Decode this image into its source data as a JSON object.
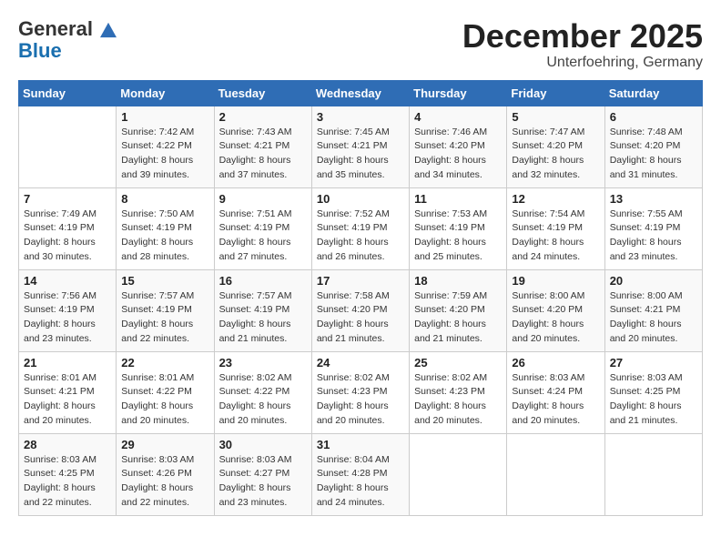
{
  "logo": {
    "general": "General",
    "blue": "Blue"
  },
  "title": "December 2025",
  "subtitle": "Unterfoehring, Germany",
  "weekdays": [
    "Sunday",
    "Monday",
    "Tuesday",
    "Wednesday",
    "Thursday",
    "Friday",
    "Saturday"
  ],
  "weeks": [
    [
      {
        "day": "",
        "sunrise": "",
        "sunset": "",
        "daylight": ""
      },
      {
        "day": "1",
        "sunrise": "7:42 AM",
        "sunset": "4:22 PM",
        "daylight": "8 hours and 39 minutes."
      },
      {
        "day": "2",
        "sunrise": "7:43 AM",
        "sunset": "4:21 PM",
        "daylight": "8 hours and 37 minutes."
      },
      {
        "day": "3",
        "sunrise": "7:45 AM",
        "sunset": "4:21 PM",
        "daylight": "8 hours and 35 minutes."
      },
      {
        "day": "4",
        "sunrise": "7:46 AM",
        "sunset": "4:20 PM",
        "daylight": "8 hours and 34 minutes."
      },
      {
        "day": "5",
        "sunrise": "7:47 AM",
        "sunset": "4:20 PM",
        "daylight": "8 hours and 32 minutes."
      },
      {
        "day": "6",
        "sunrise": "7:48 AM",
        "sunset": "4:20 PM",
        "daylight": "8 hours and 31 minutes."
      }
    ],
    [
      {
        "day": "7",
        "sunrise": "7:49 AM",
        "sunset": "4:19 PM",
        "daylight": "8 hours and 30 minutes."
      },
      {
        "day": "8",
        "sunrise": "7:50 AM",
        "sunset": "4:19 PM",
        "daylight": "8 hours and 28 minutes."
      },
      {
        "day": "9",
        "sunrise": "7:51 AM",
        "sunset": "4:19 PM",
        "daylight": "8 hours and 27 minutes."
      },
      {
        "day": "10",
        "sunrise": "7:52 AM",
        "sunset": "4:19 PM",
        "daylight": "8 hours and 26 minutes."
      },
      {
        "day": "11",
        "sunrise": "7:53 AM",
        "sunset": "4:19 PM",
        "daylight": "8 hours and 25 minutes."
      },
      {
        "day": "12",
        "sunrise": "7:54 AM",
        "sunset": "4:19 PM",
        "daylight": "8 hours and 24 minutes."
      },
      {
        "day": "13",
        "sunrise": "7:55 AM",
        "sunset": "4:19 PM",
        "daylight": "8 hours and 23 minutes."
      }
    ],
    [
      {
        "day": "14",
        "sunrise": "7:56 AM",
        "sunset": "4:19 PM",
        "daylight": "8 hours and 23 minutes."
      },
      {
        "day": "15",
        "sunrise": "7:57 AM",
        "sunset": "4:19 PM",
        "daylight": "8 hours and 22 minutes."
      },
      {
        "day": "16",
        "sunrise": "7:57 AM",
        "sunset": "4:19 PM",
        "daylight": "8 hours and 21 minutes."
      },
      {
        "day": "17",
        "sunrise": "7:58 AM",
        "sunset": "4:20 PM",
        "daylight": "8 hours and 21 minutes."
      },
      {
        "day": "18",
        "sunrise": "7:59 AM",
        "sunset": "4:20 PM",
        "daylight": "8 hours and 21 minutes."
      },
      {
        "day": "19",
        "sunrise": "8:00 AM",
        "sunset": "4:20 PM",
        "daylight": "8 hours and 20 minutes."
      },
      {
        "day": "20",
        "sunrise": "8:00 AM",
        "sunset": "4:21 PM",
        "daylight": "8 hours and 20 minutes."
      }
    ],
    [
      {
        "day": "21",
        "sunrise": "8:01 AM",
        "sunset": "4:21 PM",
        "daylight": "8 hours and 20 minutes."
      },
      {
        "day": "22",
        "sunrise": "8:01 AM",
        "sunset": "4:22 PM",
        "daylight": "8 hours and 20 minutes."
      },
      {
        "day": "23",
        "sunrise": "8:02 AM",
        "sunset": "4:22 PM",
        "daylight": "8 hours and 20 minutes."
      },
      {
        "day": "24",
        "sunrise": "8:02 AM",
        "sunset": "4:23 PM",
        "daylight": "8 hours and 20 minutes."
      },
      {
        "day": "25",
        "sunrise": "8:02 AM",
        "sunset": "4:23 PM",
        "daylight": "8 hours and 20 minutes."
      },
      {
        "day": "26",
        "sunrise": "8:03 AM",
        "sunset": "4:24 PM",
        "daylight": "8 hours and 20 minutes."
      },
      {
        "day": "27",
        "sunrise": "8:03 AM",
        "sunset": "4:25 PM",
        "daylight": "8 hours and 21 minutes."
      }
    ],
    [
      {
        "day": "28",
        "sunrise": "8:03 AM",
        "sunset": "4:25 PM",
        "daylight": "8 hours and 22 minutes."
      },
      {
        "day": "29",
        "sunrise": "8:03 AM",
        "sunset": "4:26 PM",
        "daylight": "8 hours and 22 minutes."
      },
      {
        "day": "30",
        "sunrise": "8:03 AM",
        "sunset": "4:27 PM",
        "daylight": "8 hours and 23 minutes."
      },
      {
        "day": "31",
        "sunrise": "8:04 AM",
        "sunset": "4:28 PM",
        "daylight": "8 hours and 24 minutes."
      },
      {
        "day": "",
        "sunrise": "",
        "sunset": "",
        "daylight": ""
      },
      {
        "day": "",
        "sunrise": "",
        "sunset": "",
        "daylight": ""
      },
      {
        "day": "",
        "sunrise": "",
        "sunset": "",
        "daylight": ""
      }
    ]
  ],
  "labels": {
    "sunrise_prefix": "Sunrise: ",
    "sunset_prefix": "Sunset: ",
    "daylight_prefix": "Daylight: "
  }
}
